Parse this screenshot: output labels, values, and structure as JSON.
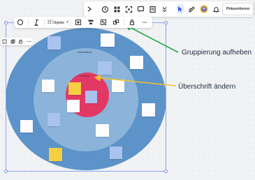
{
  "top_toolbar": {
    "icons": [
      "chevron-right-icon",
      "timer-icon",
      "grid-icon",
      "focus-icon",
      "comment-icon",
      "notes-icon",
      "more-icon"
    ],
    "active_tool": "select-cursor-icon",
    "present_label": "Präsentieren"
  },
  "selection_toolbar": {
    "count_small": "Mehr",
    "count_label": "21 Objekte"
  },
  "canvas": {
    "outer_label": "Sekundärziel",
    "inner_label": "Primäres"
  },
  "annotations": {
    "ungroup": "Gruppierung aufheben",
    "change_heading": "Überschrift ändern"
  },
  "colors": {
    "outer_ring": "#5c93c9",
    "middle_ring": "#8cb4da",
    "inner_circle": "#e43864",
    "arrow_green": "#2aa64a",
    "arrow_yellow": "#f0c12a",
    "selection": "#8ba4f3"
  }
}
